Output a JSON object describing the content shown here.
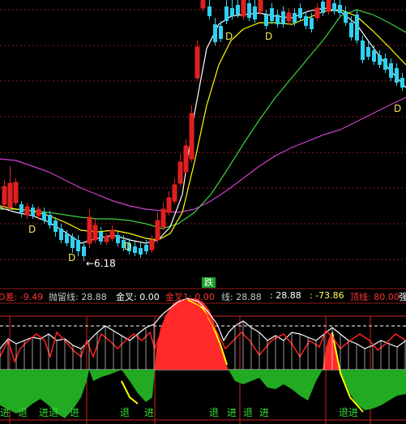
{
  "price_panel": {
    "low_label": "←6.18",
    "d_markers": [
      "D",
      "D",
      "D",
      "D",
      "D",
      "D"
    ]
  },
  "fall_badge": "跌",
  "indicator_bar": {
    "items": [
      {
        "key": "D差",
        "text": "D差: -9.49",
        "color": "#ff3333"
      },
      {
        "key": "抛留线",
        "text": "抛留线: 28.88",
        "color": "#c8c8c8"
      },
      {
        "key": "金叉",
        "text": "金叉: 0.00",
        "color": "#ffffff"
      },
      {
        "key": "金叉1",
        "text": "金叉1: 0.00",
        "color": "#ff3333"
      },
      {
        "key": "线",
        "text": "线: 28.88",
        "color": "#c8c8c8"
      },
      {
        "key": "blank",
        "text": ": 28.88",
        "color": "#ffffff"
      },
      {
        "key": "neg",
        "text": ": -73.86",
        "color": "#ffff55"
      },
      {
        "key": "顶线",
        "text": "顶线: 80.00",
        "color": "#ff3333"
      },
      {
        "key": "强",
        "text": "强",
        "color": "#ffffff"
      }
    ]
  },
  "signals": [
    {
      "text": "进",
      "color": "#33dd33"
    },
    {
      "text": "退",
      "color": "#33dd33"
    },
    {
      "text": "进",
      "color": "#33dd33"
    },
    {
      "text": "退",
      "color": "#33dd33"
    },
    {
      "text": "进",
      "color": "#33dd33"
    },
    {
      "text": "退",
      "color": "#33dd33"
    },
    {
      "text": "进",
      "color": "#33dd33"
    },
    {
      "text": "退",
      "color": "#33dd33"
    },
    {
      "text": "进",
      "color": "#33dd33"
    },
    {
      "text": "退",
      "color": "#33dd33"
    },
    {
      "text": "进",
      "color": "#33dd33"
    },
    {
      "text": "退",
      "color": "#33dd33"
    },
    {
      "text": "进",
      "color": "#33dd33"
    }
  ],
  "colors": {
    "up_candle": "#e02020",
    "down_candle": "#30d0f0",
    "grid": "#8b1a1a",
    "ma_white": "#ffffff",
    "ma_yellow": "#ffff00",
    "ma_magenta": "#d040d0",
    "ma_green": "#40d040",
    "bar_red": "#ff2a2a",
    "bar_green": "#22aa22"
  }
}
